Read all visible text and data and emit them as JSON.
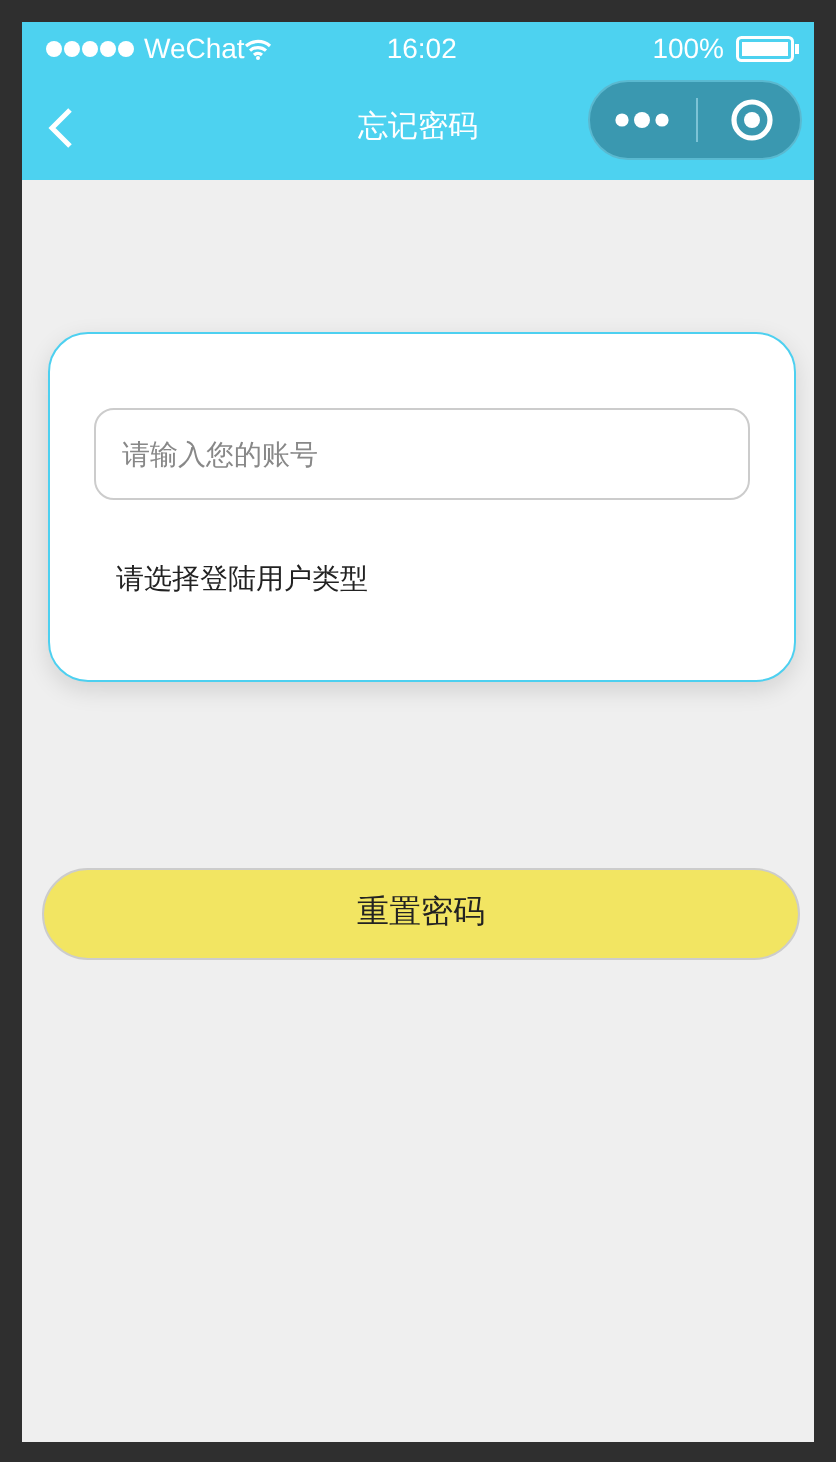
{
  "status_bar": {
    "carrier": "WeChat",
    "time": "16:02",
    "battery": "100%"
  },
  "nav": {
    "title": "忘记密码"
  },
  "form": {
    "account": {
      "placeholder": "请输入您的账号"
    },
    "user_type_prompt": "请选择登陆用户类型"
  },
  "reset_button": {
    "label": "重置密码"
  }
}
